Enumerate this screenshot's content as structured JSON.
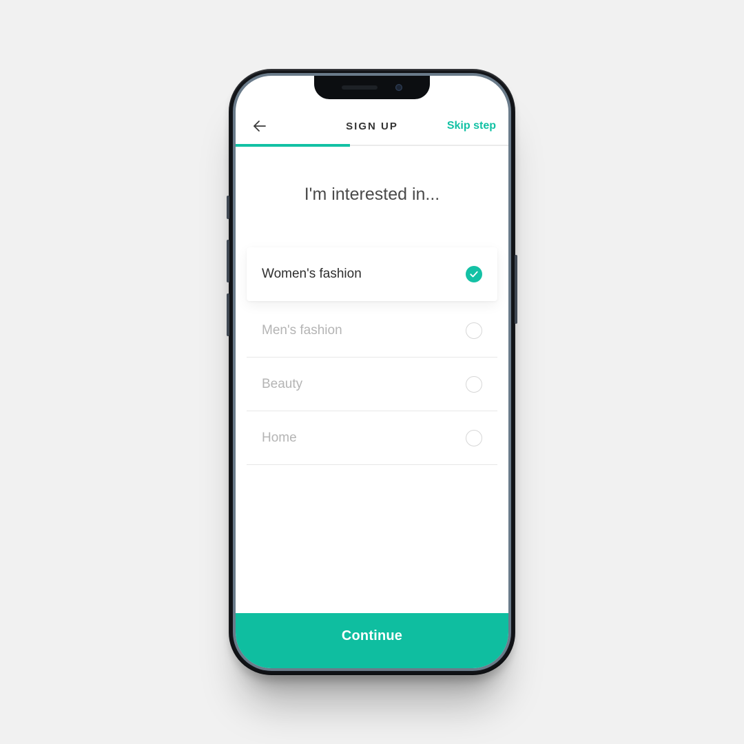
{
  "accent": "#12c1a4",
  "header": {
    "title": "SIGN UP",
    "skip_label": "Skip step",
    "progress": 0.42
  },
  "heading": "I'm interested in...",
  "options": [
    {
      "label": "Women's fashion",
      "selected": true
    },
    {
      "label": "Men's fashion",
      "selected": false
    },
    {
      "label": "Beauty",
      "selected": false
    },
    {
      "label": "Home",
      "selected": false
    }
  ],
  "cta_label": "Continue"
}
